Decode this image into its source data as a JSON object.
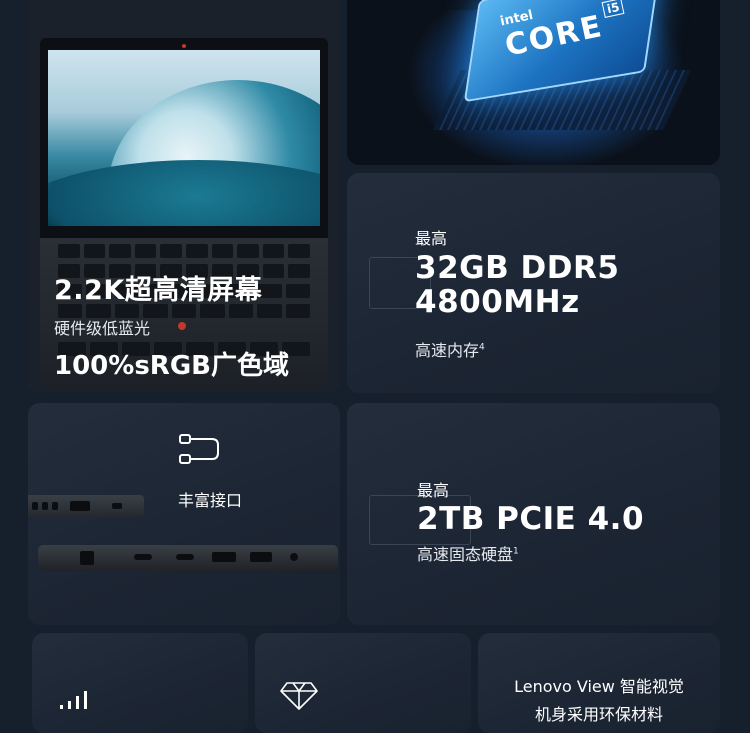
{
  "display": {
    "title": "2.2K超高清屏幕",
    "subtitle": "硬件级低蓝光",
    "gamut": "100%sRGB广色域"
  },
  "cpu": {
    "brand": "intel",
    "line": "CORE",
    "tier": "i5"
  },
  "memory": {
    "prefix": "最高",
    "capacity_line1": "32GB DDR5",
    "capacity_line2": "4800MHz",
    "note": "高速内存",
    "note_sup": "4"
  },
  "ports": {
    "label": "丰富接口"
  },
  "storage": {
    "prefix": "最高",
    "capacity": "2TB PCIE 4.0",
    "note": "高速固态硬盘",
    "note_sup": "1"
  },
  "bottom_cards": {
    "camera_line1": "Lenovo View 智能视觉",
    "camera_line2": "机身采用环保材料"
  },
  "colors": {
    "background": "#16202d",
    "panel": "#1f2937",
    "text": "#ffffff",
    "accent_red": "#c0392b",
    "cpu_blue": "#1d74c2"
  },
  "icons": [
    "signal-bars-icon",
    "diamond-icon",
    "cable-icon"
  ]
}
